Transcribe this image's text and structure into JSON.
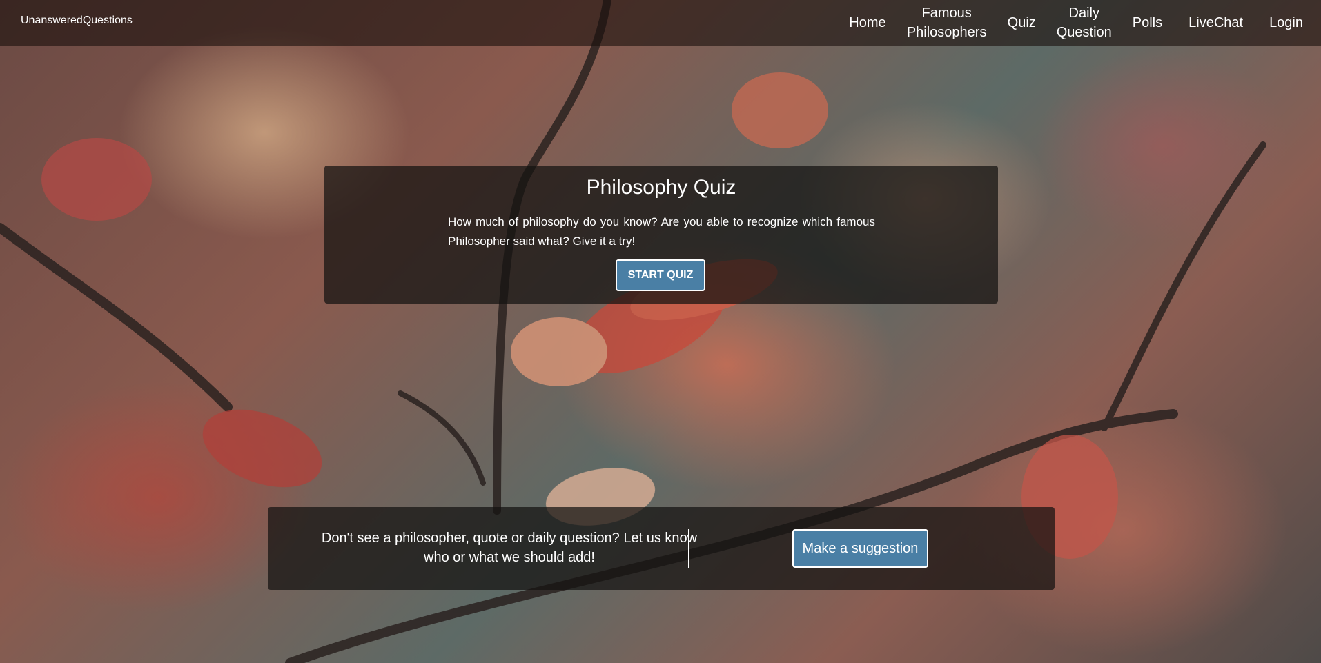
{
  "navbar": {
    "brand": "UnansweredQuestions",
    "items": [
      {
        "label": "Home"
      },
      {
        "label_line1": "Famous",
        "label_line2": "Philosophers"
      },
      {
        "label": "Quiz"
      },
      {
        "label_line1": "Daily",
        "label_line2": "Question"
      },
      {
        "label": "Polls"
      },
      {
        "label": "LiveChat"
      },
      {
        "label": "Login"
      }
    ]
  },
  "quiz": {
    "title": "Philosophy Quiz",
    "description": "How much of philosophy do you know? Are you able to recognize which famous Philosopher said what? Give it a try!",
    "button_label": "START QUIZ"
  },
  "suggestion": {
    "text": "Don't see a philosopher, quote or daily question? Let us know who or what we should add!",
    "button_label": "Make a suggestion"
  },
  "colors": {
    "button_bg": "#4a7fa5",
    "panel_bg": "rgba(20,18,16,0.72)"
  }
}
